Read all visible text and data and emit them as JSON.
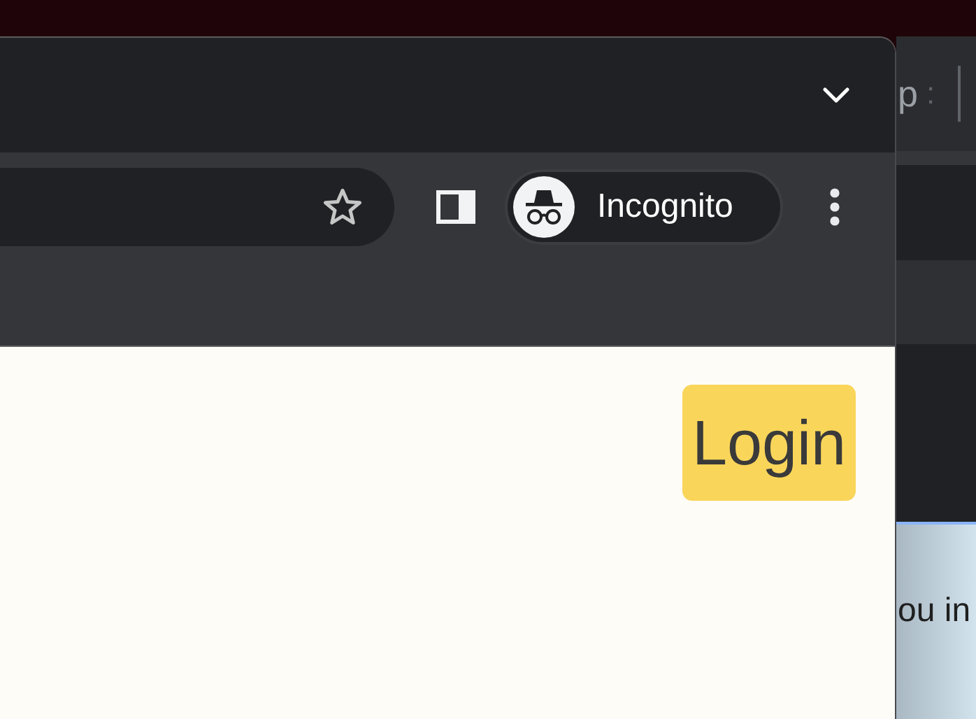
{
  "browser": {
    "toolbar": {
      "bookmark_starred": false,
      "profile_label": "Incognito"
    }
  },
  "page": {
    "login_button": "Login"
  },
  "background_window": {
    "tab_text": "p",
    "tab_menu": ":",
    "page_text": "ou in"
  }
}
